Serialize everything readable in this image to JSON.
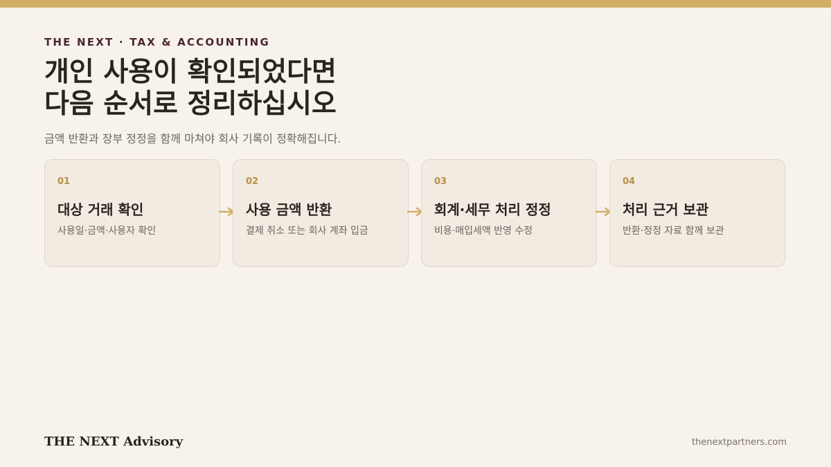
{
  "header": {
    "eyebrow": "THE NEXT · TAX & ACCOUNTING",
    "title_line1": "개인 사용이 확인되었다면",
    "title_line2": "다음 순서로 정리하십시오",
    "subtitle": "금액 반환과 장부 정정을 함께 마쳐야 회사 기록이 정확해집니다."
  },
  "steps": [
    {
      "number": "01",
      "title": "대상 거래 확인",
      "desc": "사용일·금액·사용자 확인"
    },
    {
      "number": "02",
      "title": "사용 금액 반환",
      "desc": "결제 취소 또는 회사 계좌 입금"
    },
    {
      "number": "03",
      "title": "회계·세무 처리 정정",
      "desc": "비용·매입세액 반영 수정"
    },
    {
      "number": "04",
      "title": "처리 근거 보관",
      "desc": "반환·정정 자료 함께 보관"
    }
  ],
  "footer": {
    "brand": "THE NEXT Advisory",
    "url": "thenextpartners.com"
  },
  "colors": {
    "accent_gold": "#d2ae68",
    "background": "#f7f3ec",
    "card": "#f2ebe1",
    "eyebrow": "#4a2530"
  },
  "icons": {
    "step_connector": "arrow-right-icon"
  }
}
